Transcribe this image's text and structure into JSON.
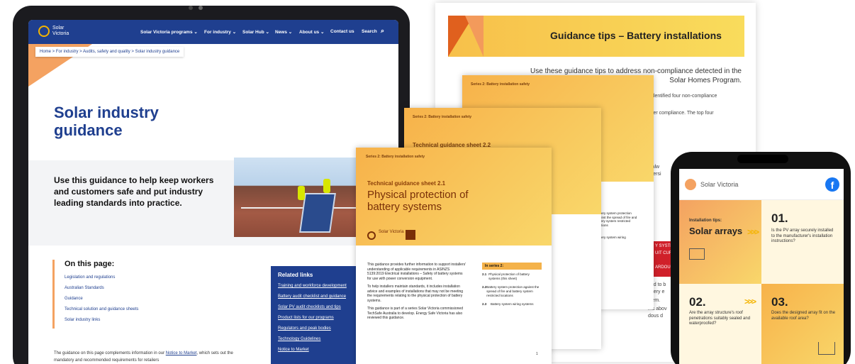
{
  "site": {
    "logo_text": "Solar Victoria",
    "nav": [
      "Solar Victoria programs ⌄",
      "For industry ⌄",
      "Solar Hub ⌄",
      "News ⌄",
      "About us ⌄",
      "Contact us",
      "Search"
    ],
    "breadcrumb": "Home > For industry > Audits, safety and quality > Solar industry guidance",
    "page_title": "Solar industry guidance",
    "intro": "Use this guidance to help keep workers and customers safe and put industry leading standards into practice.",
    "on_this_page": {
      "heading": "On this page:",
      "links": [
        "Legislation and regulations",
        "Australian Standards",
        "Guidance",
        "Technical solution and guidance sheets",
        "Solar industry links"
      ]
    },
    "related": {
      "heading": "Related links",
      "links": [
        "Training and workforce development",
        "Battery audit checklist and guidance",
        "Solar PV audit checklists and tips",
        "Product lists for our programs",
        "Regulators and peak bodies",
        "Technology Guidelines",
        "Notice to Market"
      ]
    },
    "footer_pre": "The guidance on this page complements information in our ",
    "footer_link": "Notice to Market",
    "footer_post": ", which sets out the mandatory and recommended requirements for retailers"
  },
  "doc_back": {
    "title": "Guidance tips – Battery installations",
    "intro": "Use these guidance tips to address non-compliance detected in the Solar Homes Program.",
    "frag1": "identified four non-compliance",
    "frag2": "e better compliance. The top four",
    "frag3": "rs to alw",
    "frag4": "onversi",
    "frag5": "ired to b",
    "frag6": "attery e",
    "frag7": "stem.",
    "frag8": "ms abov",
    "frag9": "dous d",
    "red1": "Y SYSTEM",
    "red2": "UIT CURR",
    "red3": "ARDOUS"
  },
  "sheet3": {
    "series": "Series 2: Battery installation safety",
    "frag": "against",
    "frag2": "y",
    "r1": "Battery system protection against the spread of fire and battery system restricted locations",
    "r2": "Battery system wiring"
  },
  "sheet2": {
    "series": "Series 2: Battery installation safety",
    "tgs": "Technical guidance sheet 2.2"
  },
  "sheet1": {
    "series": "Series 2: Battery installation safety",
    "tgs": "Technical guidance sheet 2.1",
    "title": "Physical protection of battery systems",
    "logo_text": "Solar Victoria",
    "body1": "This guidance provides further information to support installers' understanding of applicable requirements in AS/NZS 5139:2019 Electrical installations – Safety of battery systems for use with power conversion equipment.",
    "body2": "To help installers maintain standards, it includes installation advice and examples of installations that may not be meeting the requirements relating to the physical protection of battery systems.",
    "body3": "This guidance is part of a series Solar Victoria commissioned TechSafe Australia to develop. Energy Safe Victoria has also reviewed this guidance.",
    "in_series": "In series 2:",
    "items": [
      {
        "n": "2.1",
        "t": "Physical protection of battery systems (this sheet)"
      },
      {
        "n": "2.2",
        "t": "Battery system protection against the spread of fire and battery system restricted locations"
      },
      {
        "n": "2.3",
        "t": "Battery system wiring systems"
      }
    ],
    "page": "1"
  },
  "phone": {
    "app_title": "Solar Victoria",
    "tile_a": {
      "small": "Installation tips:",
      "big": "Solar arrays"
    },
    "tile_b": {
      "num": "01.",
      "q": "Is the PV array securely installed to the manufacturer's installation instructions?"
    },
    "tile_c": {
      "num": "02.",
      "q": "Are the array structure's roof penetrations suitably sealed and waterproofed?"
    },
    "tile_d": {
      "num": "03.",
      "q": "Does the designed array fit on the available roof area?"
    }
  }
}
